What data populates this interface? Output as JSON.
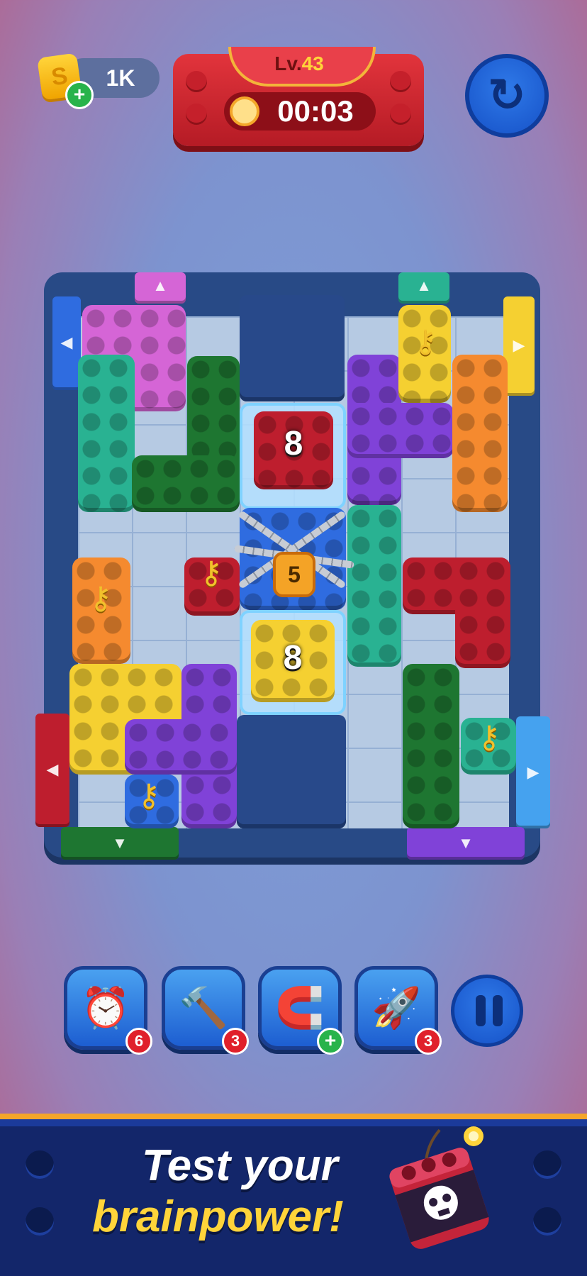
{
  "hud": {
    "coins": "1K",
    "coin_icon": "coin-s-icon",
    "level_prefix": "Lv.",
    "level_number": "43",
    "timer": "00:03",
    "restart_icon": "restart-icon"
  },
  "board": {
    "frozen_counts": [
      "8",
      "8"
    ],
    "lock_count": "5",
    "key_icon": "key-icon",
    "exit_arrow_up": "▲",
    "exit_arrow_down": "▼",
    "exit_arrow_left": "◀",
    "exit_arrow_right": "▶"
  },
  "boosters": [
    {
      "name": "freeze-clock",
      "icon": "⏰",
      "count": "6"
    },
    {
      "name": "hammer",
      "icon": "🔨",
      "count": "3"
    },
    {
      "name": "vacuum",
      "icon": "🧲",
      "count": "+"
    },
    {
      "name": "rocket",
      "icon": "🚀",
      "count": "3"
    }
  ],
  "banner": {
    "line1": "Test your",
    "line2": "brainpower!",
    "tnt_icon": "tnt-skull-icon"
  },
  "colors": {
    "accent_red": "#be1e2e",
    "accent_blue": "#1652c8",
    "banner_yellow": "#ffd43a"
  }
}
